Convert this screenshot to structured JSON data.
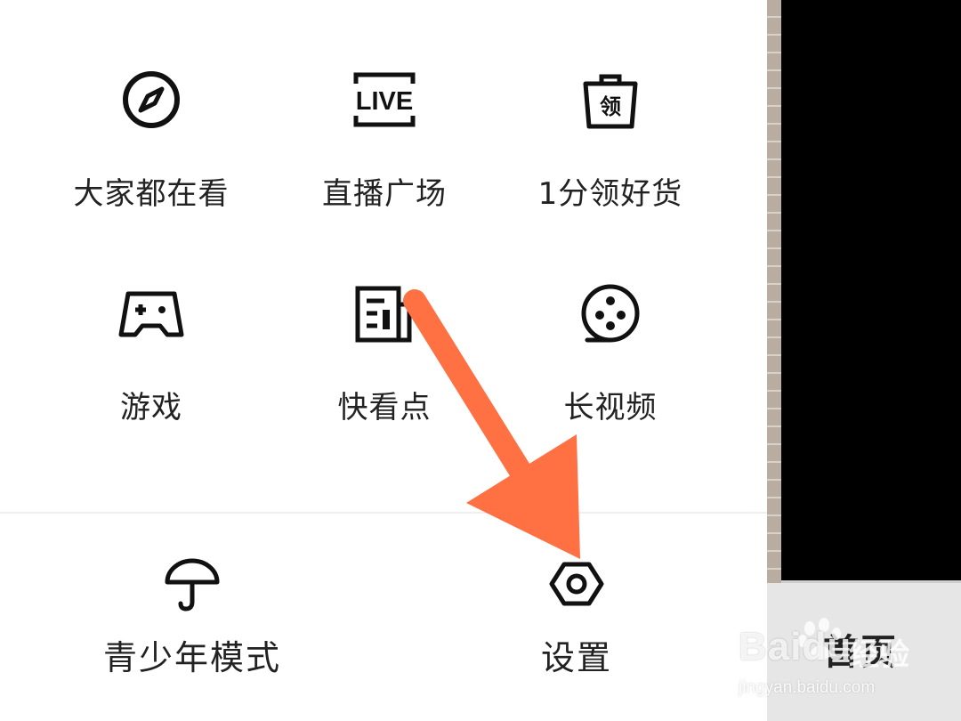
{
  "menu": {
    "grid": [
      {
        "label": "大家都在看",
        "icon": "compass-icon"
      },
      {
        "label": "直播广场",
        "icon": "live-icon"
      },
      {
        "label": "1分领好货",
        "icon": "shopping-bag-icon",
        "icon_text": "领"
      },
      {
        "label": "游戏",
        "icon": "gamepad-icon"
      },
      {
        "label": "快看点",
        "icon": "news-icon"
      },
      {
        "label": "长视频",
        "icon": "film-reel-icon"
      }
    ],
    "live_icon_text": "LIVE",
    "bottom": [
      {
        "label": "青少年模式",
        "icon": "umbrella-icon"
      },
      {
        "label": "设置",
        "icon": "settings-hex-icon"
      }
    ]
  },
  "side_tab": {
    "label": "首页"
  },
  "watermark": {
    "logo": "Baidu",
    "cn": "经验",
    "url": "jingyan.baidu.com"
  },
  "colors": {
    "accent_arrow": "#FF7043",
    "icon_stroke": "#111111",
    "text": "#222222"
  }
}
